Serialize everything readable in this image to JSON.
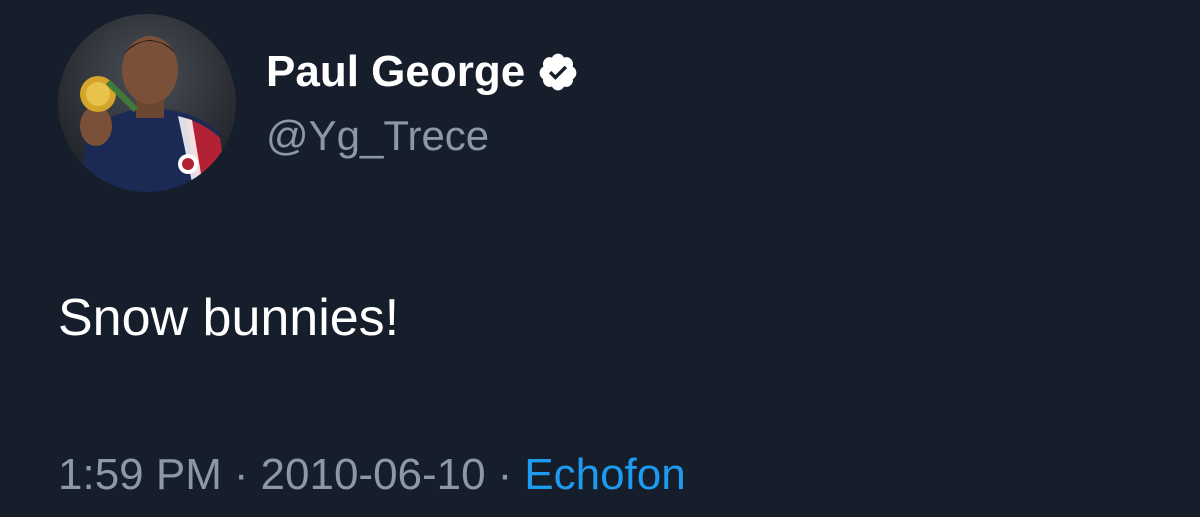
{
  "tweet": {
    "author": {
      "display_name": "Paul George",
      "handle": "@Yg_Trece",
      "verified": true,
      "verified_icon": "verified-badge-icon",
      "avatar": "profile-photo"
    },
    "text": "Snow bunnies!",
    "meta": {
      "time": "1:59 PM",
      "separator": "·",
      "date": "2010-06-10",
      "source": "Echofon"
    }
  },
  "colors": {
    "background": "#161d2b",
    "primary_text": "#ffffff",
    "secondary_text": "#8b98a5",
    "link": "#1d9bf0"
  }
}
